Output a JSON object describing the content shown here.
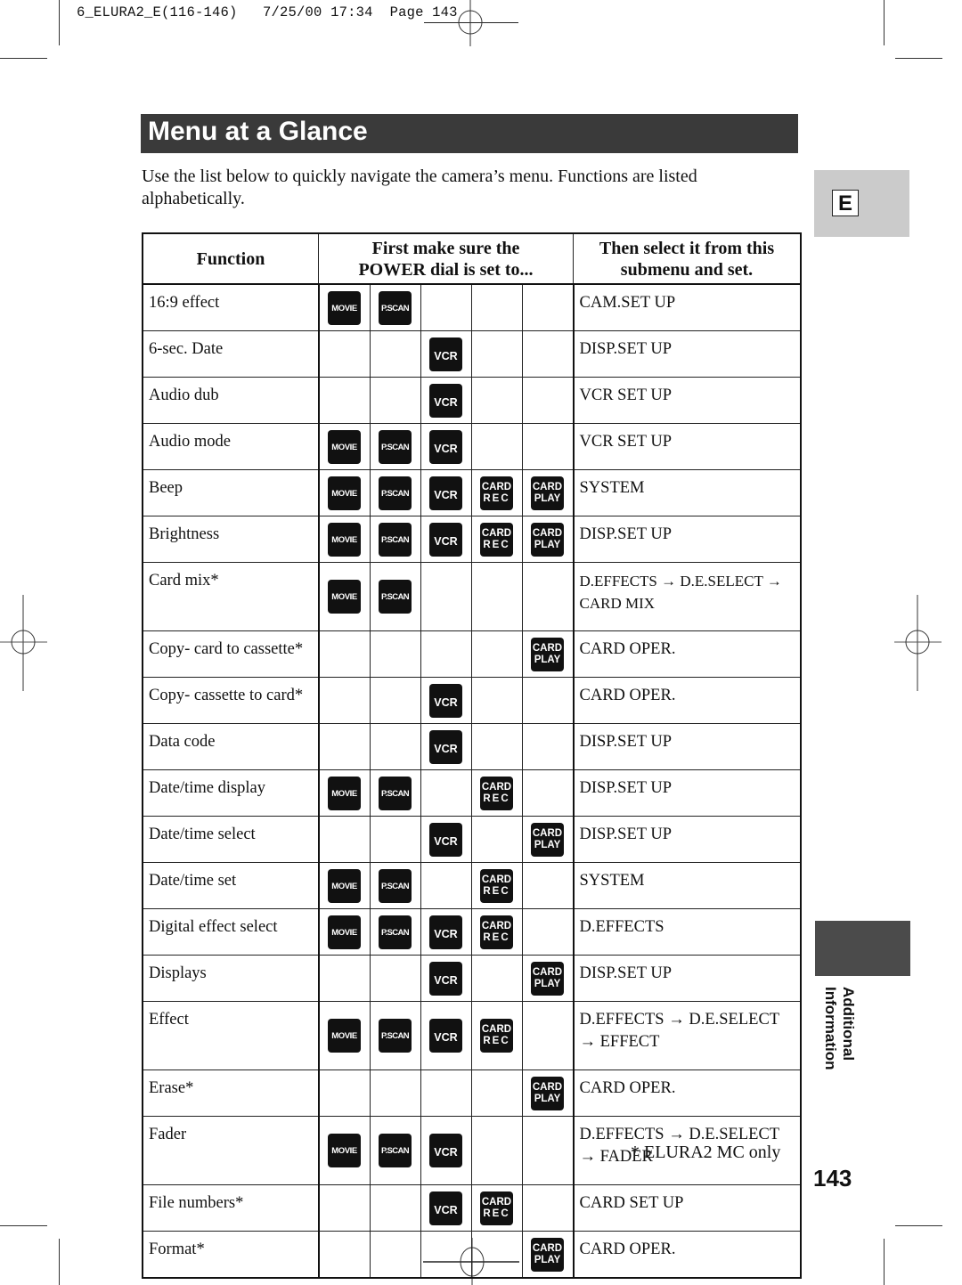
{
  "print_header": {
    "file": "6_ELURA2_E(116-146)",
    "date": "7/25/00",
    "time": "17:34",
    "page_label": "Page 143"
  },
  "title": "Menu at a Glance",
  "intro": "Use the list below to quickly navigate the camera’s menu. Functions are listed alphabetically.",
  "side_tab": {
    "letter": "E",
    "section_line1": "Additional",
    "section_line2": "Information"
  },
  "table": {
    "headers": {
      "function": "Function",
      "mode_line1": "First make sure the",
      "mode_line2": "POWER dial is set to...",
      "submenu_line1": "Then select it from this",
      "submenu_line2": "submenu and set."
    },
    "badge_labels": {
      "movie": "MOVIE",
      "pscan": "P.SCAN",
      "vcr": "VCR",
      "card_rec_top": "CARD",
      "card_rec_bottom": "REC",
      "card_play_top": "CARD",
      "card_play_bottom": "PLAY"
    },
    "rows": [
      {
        "function": "16:9 effect",
        "modes": [
          "movie",
          "pscan"
        ],
        "submenu_line1": "CAM.SET UP",
        "submenu_line2": ""
      },
      {
        "function": "6-sec. Date",
        "modes": [
          "vcr"
        ],
        "submenu_line1": "DISP.SET UP",
        "submenu_line2": ""
      },
      {
        "function": "Audio dub",
        "modes": [
          "vcr"
        ],
        "submenu_line1": "VCR SET UP",
        "submenu_line2": ""
      },
      {
        "function": "Audio mode",
        "modes": [
          "movie",
          "pscan",
          "vcr"
        ],
        "submenu_line1": "VCR SET UP",
        "submenu_line2": ""
      },
      {
        "function": "Beep",
        "modes": [
          "movie",
          "pscan",
          "vcr",
          "card_rec",
          "card_play"
        ],
        "submenu_line1": "SYSTEM",
        "submenu_line2": ""
      },
      {
        "function": "Brightness",
        "modes": [
          "movie",
          "pscan",
          "vcr",
          "card_rec",
          "card_play"
        ],
        "submenu_line1": "DISP.SET UP",
        "submenu_line2": ""
      },
      {
        "function": "Card mix*",
        "modes": [
          "movie",
          "pscan"
        ],
        "submenu_line1": "D.EFFECTS → D.E.SELECT →",
        "submenu_line2": "CARD MIX"
      },
      {
        "function": "Copy- card to cassette*",
        "modes": [
          "card_play"
        ],
        "submenu_line1": "CARD OPER.",
        "submenu_line2": ""
      },
      {
        "function": "Copy- cassette to card*",
        "modes": [
          "vcr"
        ],
        "submenu_line1": "CARD OPER.",
        "submenu_line2": ""
      },
      {
        "function": "Data code",
        "modes": [
          "vcr"
        ],
        "submenu_line1": "DISP.SET UP",
        "submenu_line2": ""
      },
      {
        "function": "Date/time display",
        "modes": [
          "movie",
          "pscan",
          "card_rec"
        ],
        "submenu_line1": "DISP.SET UP",
        "submenu_line2": ""
      },
      {
        "function": "Date/time select",
        "modes": [
          "vcr",
          "card_play"
        ],
        "submenu_line1": "DISP.SET UP",
        "submenu_line2": ""
      },
      {
        "function": "Date/time set",
        "modes": [
          "movie",
          "pscan",
          "card_rec"
        ],
        "submenu_line1": "SYSTEM",
        "submenu_line2": ""
      },
      {
        "function": "Digital effect select",
        "modes": [
          "movie",
          "pscan",
          "vcr",
          "card_rec"
        ],
        "submenu_line1": "D.EFFECTS",
        "submenu_line2": ""
      },
      {
        "function": "Displays",
        "modes": [
          "vcr",
          "card_play"
        ],
        "submenu_line1": "DISP.SET UP",
        "submenu_line2": ""
      },
      {
        "function": "Effect",
        "modes": [
          "movie",
          "pscan",
          "vcr",
          "card_rec"
        ],
        "submenu_line1": "D.EFFECTS → D.E.SELECT",
        "submenu_line2": "→ EFFECT"
      },
      {
        "function": "Erase*",
        "modes": [
          "card_play"
        ],
        "submenu_line1": "CARD OPER.",
        "submenu_line2": ""
      },
      {
        "function": "Fader",
        "modes": [
          "movie",
          "pscan",
          "vcr"
        ],
        "submenu_line1": "D.EFFECTS → D.E.SELECT",
        "submenu_line2": "→ FADER"
      },
      {
        "function": "File numbers*",
        "modes": [
          "vcr",
          "card_rec"
        ],
        "submenu_line1": "CARD SET UP",
        "submenu_line2": ""
      },
      {
        "function": "Format*",
        "modes": [
          "card_play"
        ],
        "submenu_line1": "CARD OPER.",
        "submenu_line2": ""
      }
    ]
  },
  "footnote": "* ELURA2 MC only",
  "page_number": "143"
}
